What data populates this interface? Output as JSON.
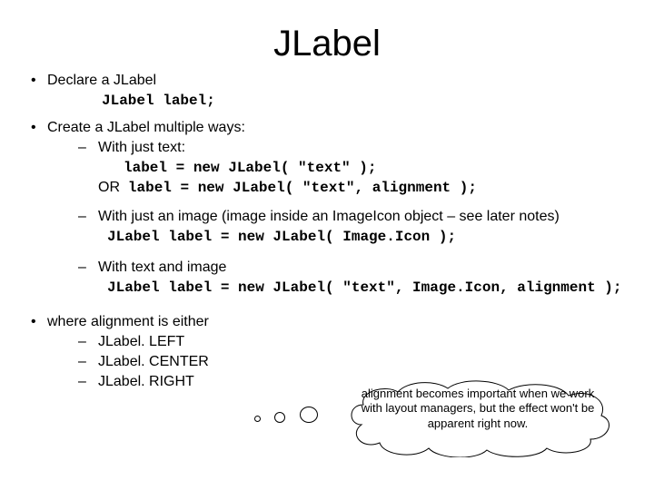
{
  "title": "JLabel",
  "bullets": {
    "declare": "Declare a JLabel",
    "declare_code": "JLabel label;",
    "create": "Create a JLabel multiple ways:",
    "with_text": "With just text:",
    "with_text_code1": "label = new JLabel( \"text\" );",
    "or_word": "OR",
    "with_text_code2": "label = new JLabel( \"text\", alignment );",
    "with_image": "With just an image (image inside an ImageIcon object – see later notes)",
    "with_image_code": "JLabel label = new JLabel( Image.Icon );",
    "with_text_image": "With  text and image",
    "with_text_image_code": "JLabel label = new JLabel( \"text\", Image.Icon, alignment );",
    "where_align": "where alignment is either",
    "align1": "JLabel. LEFT",
    "align2": "JLabel. CENTER",
    "align3": "JLabel. RIGHT"
  },
  "callout": "alignment becomes important when we work with layout managers, but the effect won't be apparent right now."
}
